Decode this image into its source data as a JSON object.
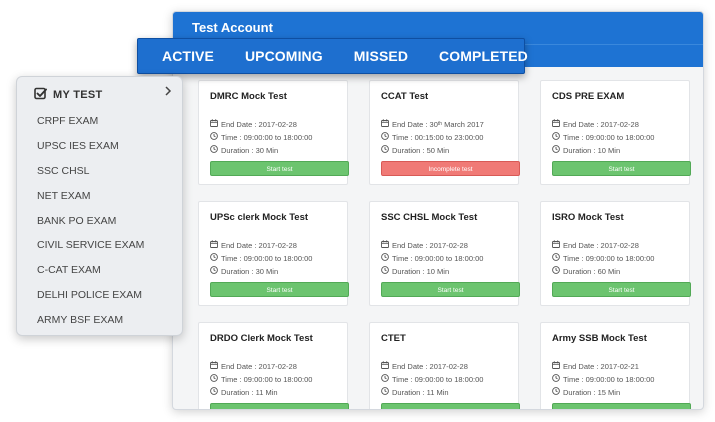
{
  "window": {
    "title": "Test Account"
  },
  "tabs": [
    {
      "label": "ACTIVE"
    },
    {
      "label": "UPCOMING"
    },
    {
      "label": "MISSED"
    },
    {
      "label": "COMPLETED"
    }
  ],
  "sidebar": {
    "title": "MY TEST",
    "items": [
      {
        "label": "CRPF EXAM"
      },
      {
        "label": "UPSC IES EXAM"
      },
      {
        "label": "SSC CHSL"
      },
      {
        "label": "NET EXAM"
      },
      {
        "label": "BANK PO EXAM"
      },
      {
        "label": "CIVIL SERVICE EXAM"
      },
      {
        "label": "C-CAT EXAM"
      },
      {
        "label": "DELHI POLICE EXAM"
      },
      {
        "label": "ARMY BSF EXAM"
      }
    ]
  },
  "cards": [
    {
      "title": "DMRC Mock Test",
      "end_date": "End Date : 2017-02-28",
      "time": "Time : 09:00:00 to 18:00:00",
      "duration": "Duration : 30 Min",
      "button": "Start test",
      "status": "start"
    },
    {
      "title": "CCAT Test",
      "end_date": "End Date : 30",
      "end_date_sup": "th",
      "end_date_tail": " March 2017",
      "time": "Time : 00:15:00 to 23:00:00",
      "duration": "Duration : 50 Min",
      "button": "Incomplete test",
      "status": "incomplete"
    },
    {
      "title": "CDS PRE EXAM",
      "end_date": "End Date : 2017-02-28",
      "time": "Time : 09:00:00 to 18:00:00",
      "duration": "Duration : 10 Min",
      "button": "Start test",
      "status": "start"
    },
    {
      "title": "UPSc clerk Mock Test",
      "end_date": "End Date : 2017-02-28",
      "time": "Time : 09:00:00 to 18:00:00",
      "duration": "Duration : 30 Min",
      "button": "Start test",
      "status": "start"
    },
    {
      "title": "SSC CHSL Mock Test",
      "end_date": "End Date : 2017-02-28",
      "time": "Time : 09:00:00 to 18:00:00",
      "duration": "Duration : 10 Min",
      "button": "Start test",
      "status": "start"
    },
    {
      "title": "ISRO Mock Test",
      "end_date": "End Date : 2017-02-28",
      "time": "Time : 09:00:00 to 18:00:00",
      "duration": "Duration : 60 Min",
      "button": "Start test",
      "status": "start"
    },
    {
      "title": "DRDO Clerk Mock Test",
      "end_date": "End Date : 2017-02-28",
      "time": "Time : 09:00:00 to 18:00:00",
      "duration": "Duration : 11 Min",
      "button": "",
      "status": "start"
    },
    {
      "title": "CTET",
      "end_date": "End Date : 2017-02-28",
      "time": "Time : 09:00:00 to 18:00:00",
      "duration": "Duration : 11 Min",
      "button": "",
      "status": "start"
    },
    {
      "title": "Army SSB Mock Test",
      "end_date": "End Date : 2017-02-21",
      "time": "Time : 09:00:00 to 18:00:00",
      "duration": "Duration : 15 Min",
      "button": "",
      "status": "start"
    }
  ],
  "icons": {
    "calendar": "calendar-icon",
    "clock": "clock-icon",
    "checkbox": "checkbox-icon",
    "chevron": "chevron-right-icon"
  },
  "colors": {
    "primary": "#1e73d3",
    "start_button": "#6cc46f",
    "incomplete_button": "#f07a76"
  }
}
